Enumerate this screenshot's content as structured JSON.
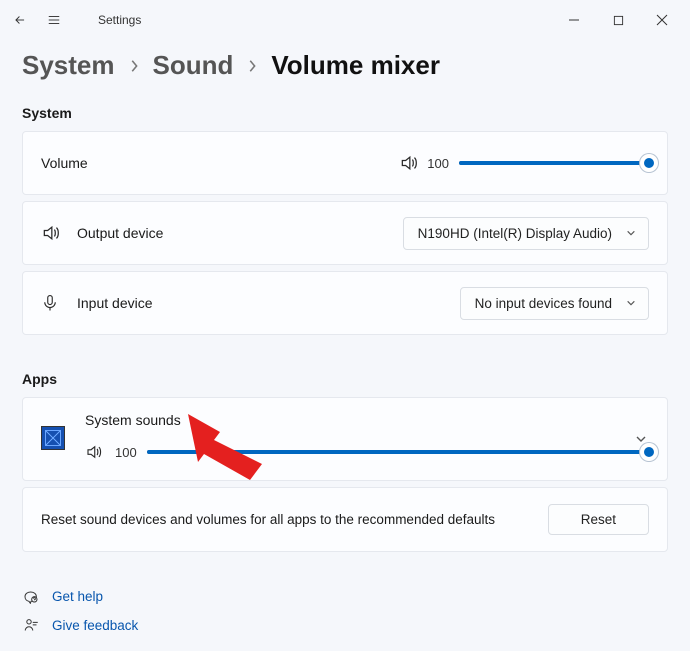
{
  "titlebar": {
    "title": "Settings"
  },
  "breadcrumb": {
    "level1": "System",
    "level2": "Sound",
    "level3": "Volume mixer"
  },
  "sections": {
    "system_heading": "System",
    "apps_heading": "Apps"
  },
  "volume": {
    "label": "Volume",
    "value": "100",
    "percent": 100
  },
  "output": {
    "label": "Output device",
    "selected": "N190HD (Intel(R) Display Audio)"
  },
  "input": {
    "label": "Input device",
    "selected": "No input devices found"
  },
  "app": {
    "name": "System sounds",
    "value": "100",
    "percent": 100
  },
  "reset": {
    "text": "Reset sound devices and volumes for all apps to the recommended defaults",
    "button": "Reset"
  },
  "links": {
    "help": "Get help",
    "feedback": "Give feedback"
  }
}
